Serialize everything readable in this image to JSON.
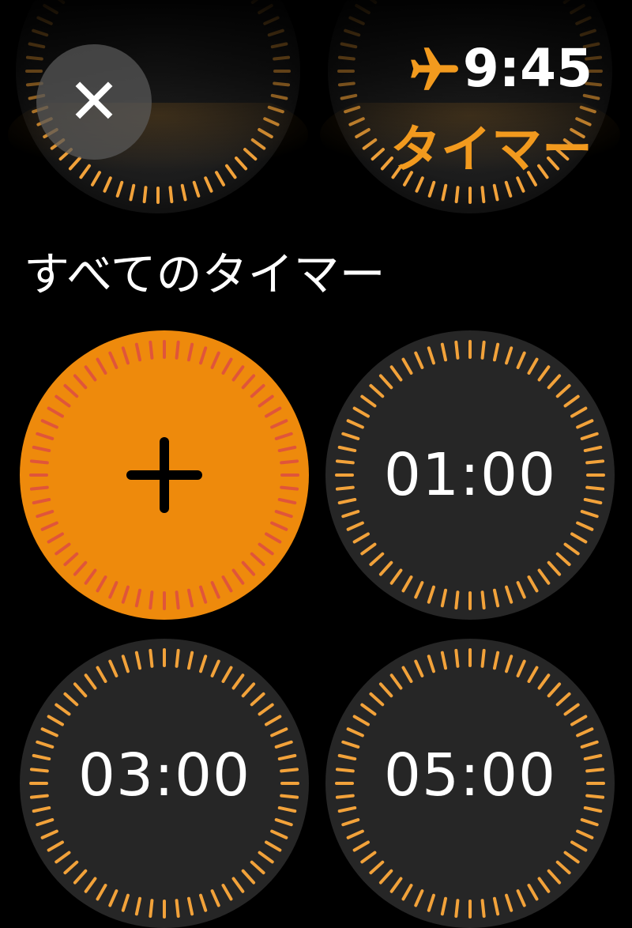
{
  "status_bar": {
    "time": "9:45",
    "airplane_icon": "airplane-icon"
  },
  "header": {
    "close_icon": "close-icon",
    "close_glyph": "✕",
    "app_title": "タイマー"
  },
  "section_title": "すべてのタイマー",
  "timers": [
    {
      "type": "add",
      "icon": "plus-icon"
    },
    {
      "type": "preset",
      "label": "01:00"
    },
    {
      "type": "preset",
      "label": "03:00"
    },
    {
      "type": "preset",
      "label": "05:00"
    }
  ],
  "colors": {
    "accent": "#f29a1e",
    "add_button_fill": "#ee8a0c",
    "add_button_ticks": "#e0553a",
    "dial_fill": "#262626",
    "tick": "#f2a23a"
  }
}
